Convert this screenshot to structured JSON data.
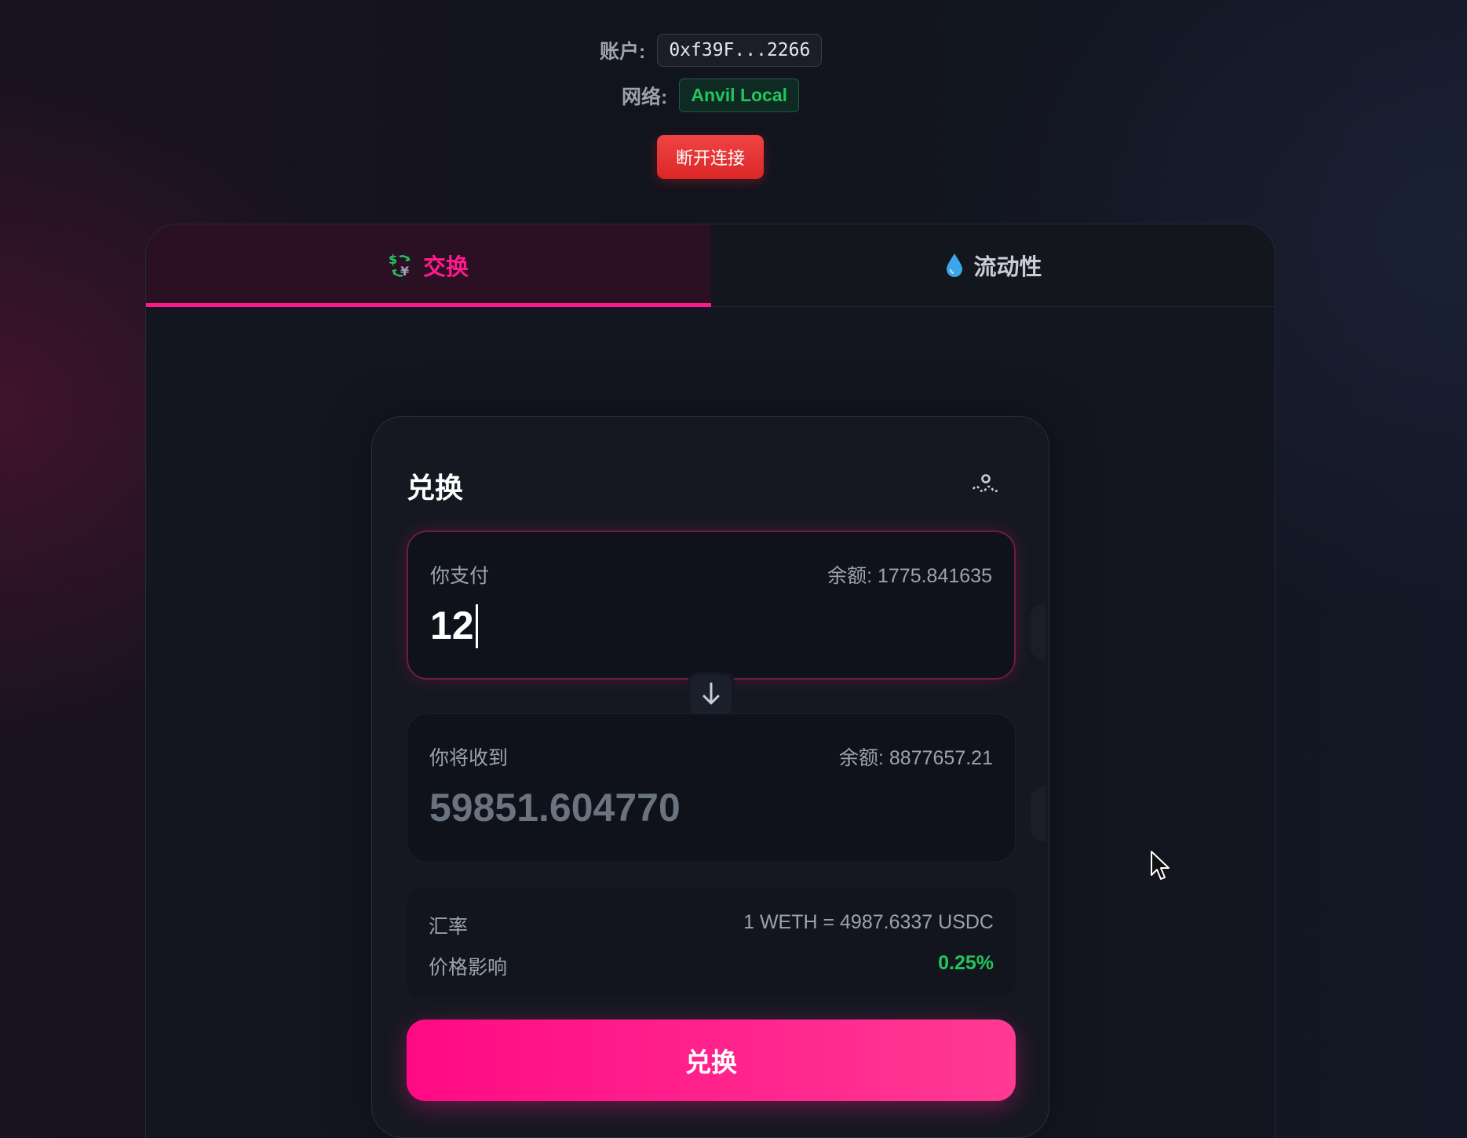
{
  "header": {
    "account_label": "账户:",
    "account_value": "0xf39F...2266",
    "network_label": "网络:",
    "network_value": "Anvil Local",
    "disconnect_label": "断开连接"
  },
  "tabs": [
    {
      "label": "交换",
      "icon": "currency-exchange-icon",
      "active": true
    },
    {
      "label": "流动性",
      "icon": "droplet-icon",
      "active": false
    }
  ],
  "swap": {
    "title": "兑换",
    "settings_icon": "settings-icon",
    "pay": {
      "label": "你支付",
      "balance": "余额: 1775.841635",
      "amount": "12"
    },
    "receive": {
      "label": "你将收到",
      "balance": "余额: 8877657.21",
      "amount": "59851.604770"
    },
    "rate_label": "汇率",
    "rate_value": "1 WETH = 4987.6337 USDC",
    "impact_label": "价格影响",
    "impact_value": "0.25%",
    "submit_label": "兑换"
  },
  "colors": {
    "accent": "#ff1a8c",
    "danger": "#dc2626",
    "success": "#22c55e"
  }
}
